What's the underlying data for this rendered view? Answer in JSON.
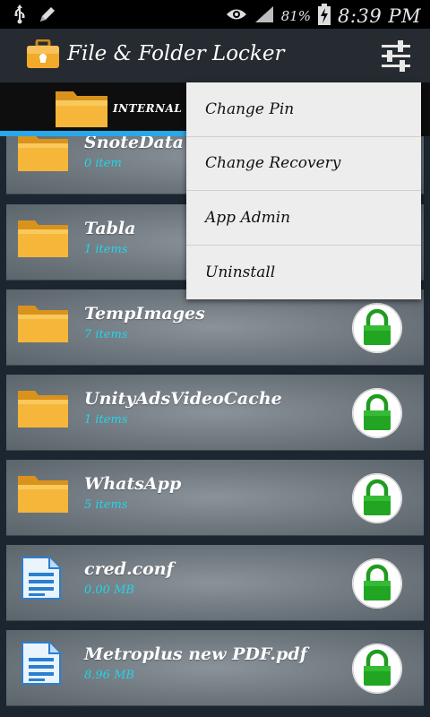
{
  "status_bar": {
    "icons": [
      "usb-icon",
      "pencil-icon",
      "eye-icon",
      "signal-icon",
      "battery-charging-icon"
    ],
    "battery_percent": "81%",
    "time": "8:39 PM"
  },
  "action_bar": {
    "title": "File & Folder Locker",
    "app_icon": "briefcase-lock-icon",
    "settings_icon": "sliders-icon"
  },
  "tabs": [
    {
      "label": "INTERNAL",
      "icon": "folder-icon",
      "selected": true
    }
  ],
  "menu": {
    "items": [
      {
        "label": "Change Pin"
      },
      {
        "label": "Change Recovery"
      },
      {
        "label": "App Admin"
      },
      {
        "label": "Uninstall"
      }
    ]
  },
  "items": [
    {
      "name": "SnoteData",
      "count": "0 item",
      "type": "folder"
    },
    {
      "name": "Tabla",
      "count": "1 items",
      "type": "folder"
    },
    {
      "name": "TempImages",
      "count": "7 items",
      "type": "folder"
    },
    {
      "name": "UnityAdsVideoCache",
      "count": "1 items",
      "type": "folder"
    },
    {
      "name": "WhatsApp",
      "count": "5 items",
      "type": "folder"
    },
    {
      "name": "cred.conf",
      "count": "0.00 MB",
      "type": "file"
    },
    {
      "name": "Metroplus new PDF.pdf",
      "count": "8.96 MB",
      "type": "file"
    }
  ],
  "colors": {
    "accent": "#2aa7e8",
    "count_text": "#22d6e6",
    "lock_green": "#1fa51f",
    "folder": "#f2b134"
  }
}
